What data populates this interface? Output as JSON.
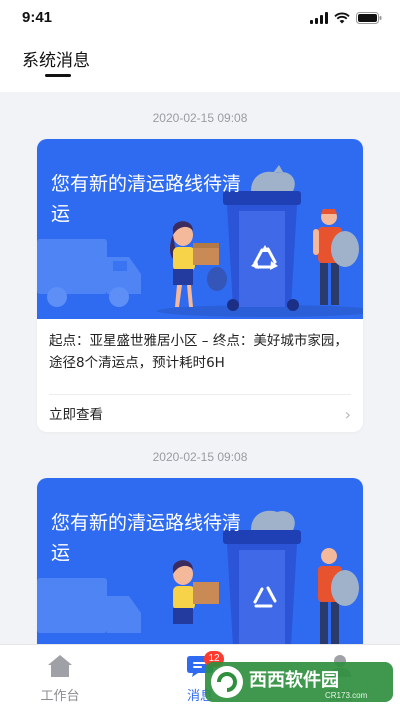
{
  "status_bar": {
    "time": "9:41"
  },
  "header": {
    "title": "系统消息"
  },
  "messages": [
    {
      "timestamp": "2020-02-15 09:08",
      "banner_title": "您有新的清运路线待清运",
      "description": "起点：亚星盛世雅居小区 – 终点：美好城市家园，途径8个清运点，预计耗时6H",
      "action_label": "立即查看"
    },
    {
      "timestamp": "2020-02-15 09:08",
      "banner_title": "您有新的清运路线待清运"
    }
  ],
  "tabs": [
    {
      "label": "工作台",
      "icon": "home-icon"
    },
    {
      "label": "消息",
      "icon": "message-icon",
      "badge": "12",
      "active": true
    },
    {
      "label": "我的",
      "icon": "user-icon"
    }
  ],
  "watermark": {
    "text": "西西软件园",
    "sub": "CR173.com"
  },
  "colors": {
    "accent": "#2f6bf1",
    "badge": "#ff3b30",
    "background": "#f2f3f6"
  }
}
